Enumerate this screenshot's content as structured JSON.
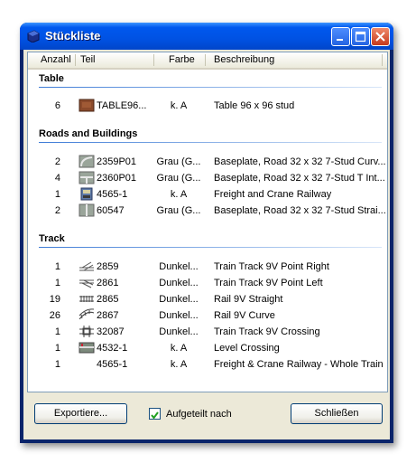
{
  "window": {
    "title": "Stückliste"
  },
  "columns": {
    "anzahl": "Anzahl",
    "teil": "Teil",
    "farbe": "Farbe",
    "beschreibung": "Beschreibung"
  },
  "groups": [
    {
      "label": "Table"
    },
    {
      "label": "Roads and Buildings"
    },
    {
      "label": "Track"
    }
  ],
  "rows": [
    {
      "anzahl": "6",
      "teil": "TABLE96...",
      "farbe": "k. A",
      "beschreibung": "Table 96 x 96 stud"
    },
    {
      "anzahl": "2",
      "teil": "2359P01",
      "farbe": "Grau (G...",
      "beschreibung": "Baseplate, Road 32 x 32 7-Stud Curv..."
    },
    {
      "anzahl": "4",
      "teil": "2360P01",
      "farbe": "Grau (G...",
      "beschreibung": "Baseplate, Road 32 x 32 7-Stud T Int..."
    },
    {
      "anzahl": "1",
      "teil": "4565-1",
      "farbe": "k. A",
      "beschreibung": "Freight and Crane Railway"
    },
    {
      "anzahl": "2",
      "teil": "60547",
      "farbe": "Grau (G...",
      "beschreibung": "Baseplate, Road 32 x 32 7-Stud Strai..."
    },
    {
      "anzahl": "1",
      "teil": "2859",
      "farbe": "Dunkel...",
      "beschreibung": "Train Track 9V Point Right"
    },
    {
      "anzahl": "1",
      "teil": "2861",
      "farbe": "Dunkel...",
      "beschreibung": "Train Track 9V Point Left"
    },
    {
      "anzahl": "19",
      "teil": "2865",
      "farbe": "Dunkel...",
      "beschreibung": "Rail 9V Straight"
    },
    {
      "anzahl": "26",
      "teil": "2867",
      "farbe": "Dunkel...",
      "beschreibung": "Rail 9V Curve"
    },
    {
      "anzahl": "1",
      "teil": "32087",
      "farbe": "Dunkel...",
      "beschreibung": "Train Track 9V Crossing"
    },
    {
      "anzahl": "1",
      "teil": "4532-1",
      "farbe": "k. A",
      "beschreibung": "Level Crossing"
    },
    {
      "anzahl": "1",
      "teil": "4565-1",
      "farbe": "k. A",
      "beschreibung": "Freight & Crane Railway - Whole Train"
    }
  ],
  "footer": {
    "export_label": "Exportiere...",
    "checkbox_label": "Aufgeteilt nach",
    "checkbox_checked": true,
    "close_label": "Schließen"
  }
}
